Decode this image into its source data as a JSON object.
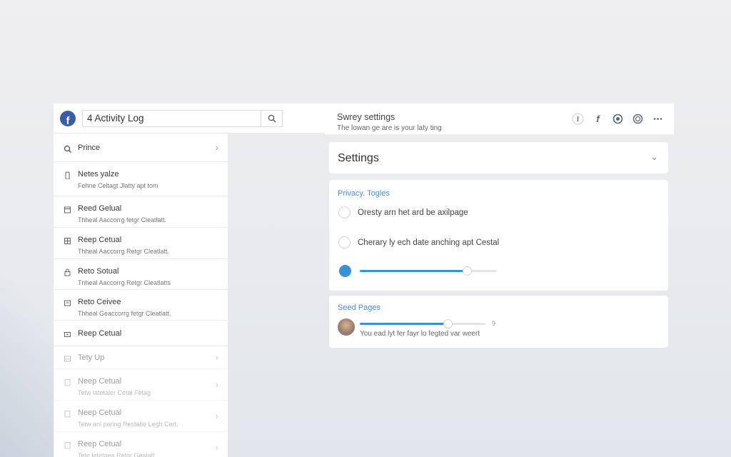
{
  "search": {
    "value": "4 Activity Log"
  },
  "sidebar": {
    "items": [
      {
        "label": "Prince",
        "sub": "",
        "icon": "search-icon",
        "chevron": true
      },
      {
        "label": "Netes yalze",
        "sub": "Fehne Celtagt Jlatty apt tom",
        "icon": "phone-icon",
        "chevron": false
      },
      {
        "label": "Reed Gelual",
        "sub": "Thheal Aaccorrg fetgr Cleatlatt.",
        "icon": "calendar-icon",
        "chevron": false
      },
      {
        "label": "Reep Cetual",
        "sub": "Thheal Aaccorrg Retgr Cleatlatt.",
        "icon": "grid-icon",
        "chevron": false
      },
      {
        "label": "Reto Sotual",
        "sub": "Tnheal Aaccorrg Retgr Cleatlatts",
        "icon": "lock-icon",
        "chevron": false
      },
      {
        "label": "Reto Ceivee",
        "sub": "Thheal Geaccorrg fetgr Cleatlatt.",
        "icon": "message-icon",
        "chevron": false
      },
      {
        "label": "Reep Cetual",
        "sub": "",
        "icon": "video-icon",
        "chevron": false
      },
      {
        "label": "Tety Up",
        "sub": "",
        "icon": "image-icon",
        "chevron": true
      },
      {
        "label": "Neep Cetual",
        "sub": "Tetw latetaler Cetal Fetag",
        "icon": "doc-icon",
        "chevron": true
      },
      {
        "label": "Neep Cetual",
        "sub": "Tetw anl pering Restatle Legh Cert.",
        "icon": "doc-icon",
        "chevron": true
      },
      {
        "label": "Reep Cetual",
        "sub": "Tete letetaea Retgr Gealatt.",
        "icon": "doc-icon",
        "chevron": true
      }
    ]
  },
  "header": {
    "title": "Swrey settings",
    "subtitle": "The lowan ge are is your laty ting",
    "icons": [
      "info-icon",
      "facebook-icon",
      "messenger-icon",
      "globe-icon",
      "more-icon"
    ]
  },
  "settings": {
    "title": "Settings"
  },
  "privacy": {
    "title": "Privacy. Togles",
    "options": [
      "Oresty arn het ard be axilpage",
      "Cherary ly ech date anching apt Cestal"
    ],
    "slider_level": 0.78
  },
  "saved": {
    "title": "Seed Pages",
    "slider_level": 0.7,
    "value_label": "9",
    "description": "You ead lyt fer fayr lo fegted var weert"
  },
  "colors": {
    "accent": "#3a8fd9",
    "brand": "#3b5ca8"
  }
}
